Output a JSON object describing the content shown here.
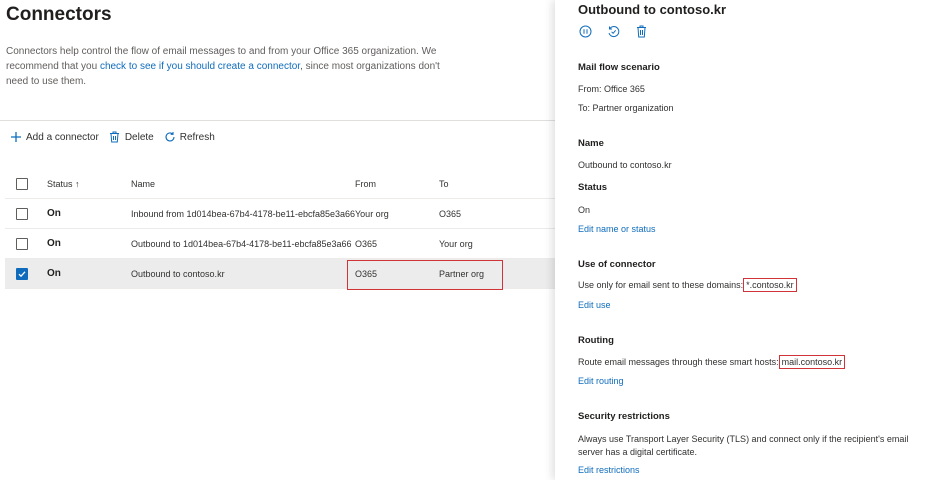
{
  "page": {
    "title": "Connectors",
    "description_before": "Connectors help control the flow of email messages to and from your Office 365 organization. We recommend that you ",
    "description_link": "check to see if you should create a connector",
    "description_after": ", since most organizations don't need to use them."
  },
  "toolbar": {
    "add_label": "Add a connector",
    "delete_label": "Delete",
    "refresh_label": "Refresh"
  },
  "table": {
    "headers": {
      "status": "Status",
      "sort_indicator": "↑",
      "name": "Name",
      "from": "From",
      "to": "To"
    },
    "rows": [
      {
        "status": "On",
        "name": "Inbound from 1d014bea-67b4-4178-be11-ebcfa85e3a66",
        "from": "Your org",
        "to": "O365",
        "selected": false
      },
      {
        "status": "On",
        "name": "Outbound to 1d014bea-67b4-4178-be11-ebcfa85e3a66",
        "from": "O365",
        "to": "Your org",
        "selected": false
      },
      {
        "status": "On",
        "name": "Outbound to contoso.kr",
        "from": "O365",
        "to": "Partner org",
        "selected": true
      }
    ]
  },
  "panel": {
    "title": "Outbound to contoso.kr",
    "mail_flow": {
      "heading": "Mail flow scenario",
      "from": "From: Office 365",
      "to": "To: Partner organization"
    },
    "name": {
      "heading": "Name",
      "value": "Outbound to contoso.kr"
    },
    "status": {
      "heading": "Status",
      "value": "On",
      "link": "Edit name or status"
    },
    "use": {
      "heading": "Use of connector",
      "text": "Use only for email sent to these domains:",
      "value": "*.contoso.kr",
      "link": "Edit use"
    },
    "routing": {
      "heading": "Routing",
      "text": "Route email messages through these smart hosts:",
      "value": "mail.contoso.kr",
      "link": "Edit routing"
    },
    "security": {
      "heading": "Security restrictions",
      "text": "Always use Transport Layer Security (TLS) and connect only if the recipient's email server has a digital certificate.",
      "link": "Edit restrictions"
    }
  },
  "colors": {
    "accent": "#0f6cbd",
    "highlight": "#d13438",
    "selected_row": "#ececec"
  }
}
